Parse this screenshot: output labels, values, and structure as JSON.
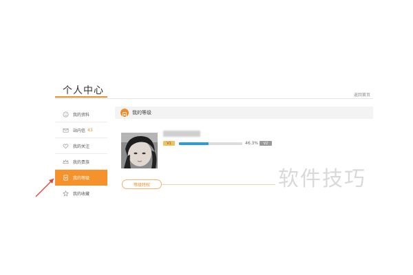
{
  "header": {
    "title": "个人中心",
    "home_link": "返回首页"
  },
  "sidebar": {
    "items": [
      {
        "label": "我的资料",
        "icon": "smiley-icon"
      },
      {
        "label": "站内信",
        "badge": "43",
        "icon": "mail-icon"
      },
      {
        "label": "我的关注",
        "icon": "heart-icon"
      },
      {
        "label": "我的贵族",
        "icon": "crown-icon"
      },
      {
        "label": "我的等级",
        "icon": "level-icon",
        "active": true
      },
      {
        "label": "我的收藏",
        "icon": "star-icon"
      }
    ]
  },
  "section": {
    "title": "我的等级",
    "icon": "level-icon"
  },
  "profile": {
    "level_badge": "V1",
    "progress_percent": 46.3,
    "progress_text": "46.3%",
    "next_level": "V2"
  },
  "privilege_button": "等级特权",
  "watermark": "软件技巧",
  "colors": {
    "accent": "#f5922b",
    "progress": "#2b9be0",
    "annotation_arrow": "#d9473b"
  }
}
